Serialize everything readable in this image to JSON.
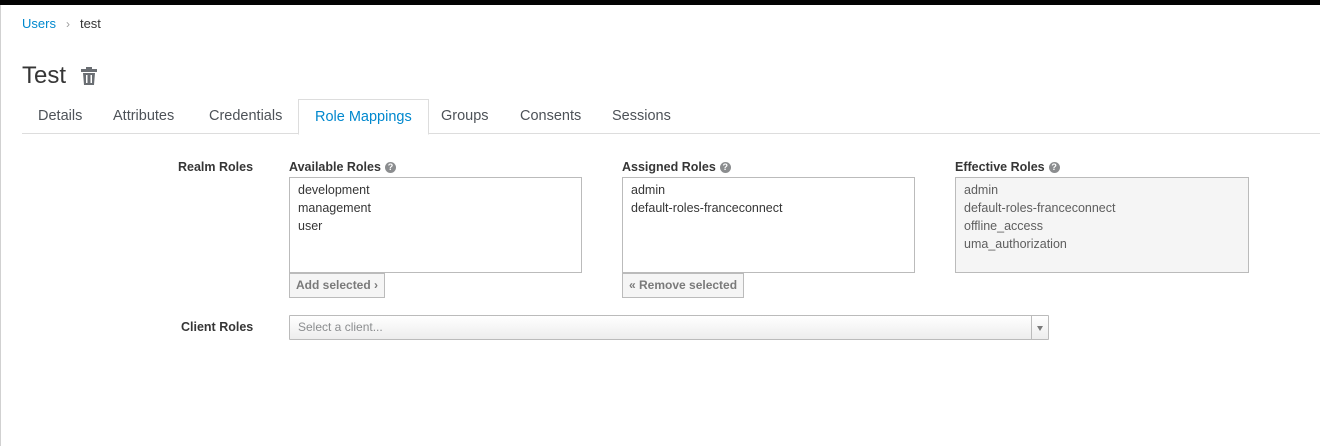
{
  "breadcrumb": {
    "parent": "Users",
    "separator": "›",
    "current": "test"
  },
  "page": {
    "title": "Test"
  },
  "tabs": [
    {
      "label": "Details"
    },
    {
      "label": "Attributes"
    },
    {
      "label": "Credentials"
    },
    {
      "label": "Role Mappings",
      "active": true
    },
    {
      "label": "Groups"
    },
    {
      "label": "Consents"
    },
    {
      "label": "Sessions"
    }
  ],
  "realm_roles": {
    "label": "Realm Roles",
    "available": {
      "title": "Available Roles",
      "items": [
        "development",
        "management",
        "user"
      ]
    },
    "assigned": {
      "title": "Assigned Roles",
      "items": [
        "admin",
        "default-roles-franceconnect"
      ]
    },
    "effective": {
      "title": "Effective Roles",
      "items": [
        "admin",
        "default-roles-franceconnect",
        "offline_access",
        "uma_authorization"
      ]
    },
    "add_button": "Add selected ›",
    "remove_button": "« Remove selected"
  },
  "client_roles": {
    "label": "Client Roles",
    "placeholder": "Select a client..."
  },
  "colors": {
    "link": "#0088ce",
    "text": "#363636",
    "border": "#bbbbbb",
    "readonly_bg": "#f5f5f5"
  },
  "icons": {
    "delete": "trash-icon",
    "help": "help-icon",
    "dropdown": "chevron-down-icon"
  }
}
